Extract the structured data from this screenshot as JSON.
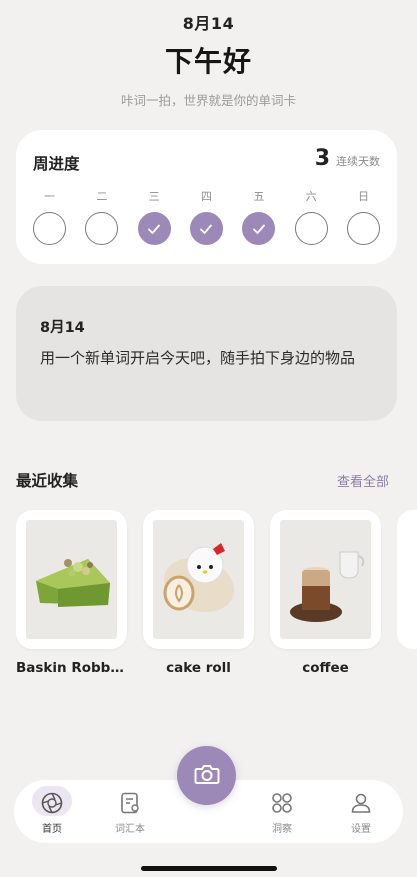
{
  "header": {
    "date": "8月14",
    "greeting": "下午好",
    "tagline": "咔词一拍，世界就是你的单词卡"
  },
  "week_progress": {
    "title": "周进度",
    "streak_count": "3",
    "streak_label": "连续天数",
    "days": [
      {
        "label": "一",
        "done": false
      },
      {
        "label": "二",
        "done": false
      },
      {
        "label": "三",
        "done": true
      },
      {
        "label": "四",
        "done": true
      },
      {
        "label": "五",
        "done": true
      },
      {
        "label": "六",
        "done": false
      },
      {
        "label": "日",
        "done": false
      }
    ],
    "accent_color": "#9c89b8"
  },
  "daily_card": {
    "date": "8月14",
    "text": "用一个新单词开启今天吧，随手拍下身边的物品"
  },
  "recent": {
    "title": "最近收集",
    "see_all": "查看全部",
    "items": [
      {
        "name": "Baskin Robbi...",
        "icon": "matcha-cake-photo"
      },
      {
        "name": "cake roll",
        "icon": "cake-roll-photo"
      },
      {
        "name": "coffee",
        "icon": "coffee-photo"
      }
    ]
  },
  "tabbar": {
    "tabs": [
      {
        "label": "首页",
        "icon": "aperture-icon",
        "active": true
      },
      {
        "label": "词汇本",
        "icon": "notebook-icon",
        "active": false
      },
      {
        "label": "洞察",
        "icon": "grid-circles-icon",
        "active": false
      },
      {
        "label": "设置",
        "icon": "person-icon",
        "active": false
      }
    ],
    "camera_icon": "camera-icon"
  }
}
